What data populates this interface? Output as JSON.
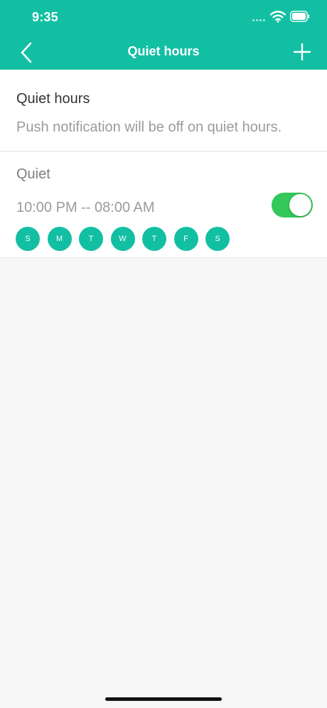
{
  "status_bar": {
    "time": "9:35"
  },
  "header": {
    "title": "Quiet hours",
    "back_icon": "chevron-left-icon",
    "add_icon": "plus-icon",
    "background": "#12bfa3"
  },
  "intro": {
    "title": "Quiet hours",
    "description": "Push notification will be off on quiet hours."
  },
  "rule": {
    "name": "Quiet",
    "time_range": "10:00 PM -- 08:00 AM",
    "enabled": true,
    "toggle_color": "#34c759",
    "days": [
      "S",
      "M",
      "T",
      "W",
      "T",
      "F",
      "S"
    ],
    "day_color": "#12bfa3"
  }
}
